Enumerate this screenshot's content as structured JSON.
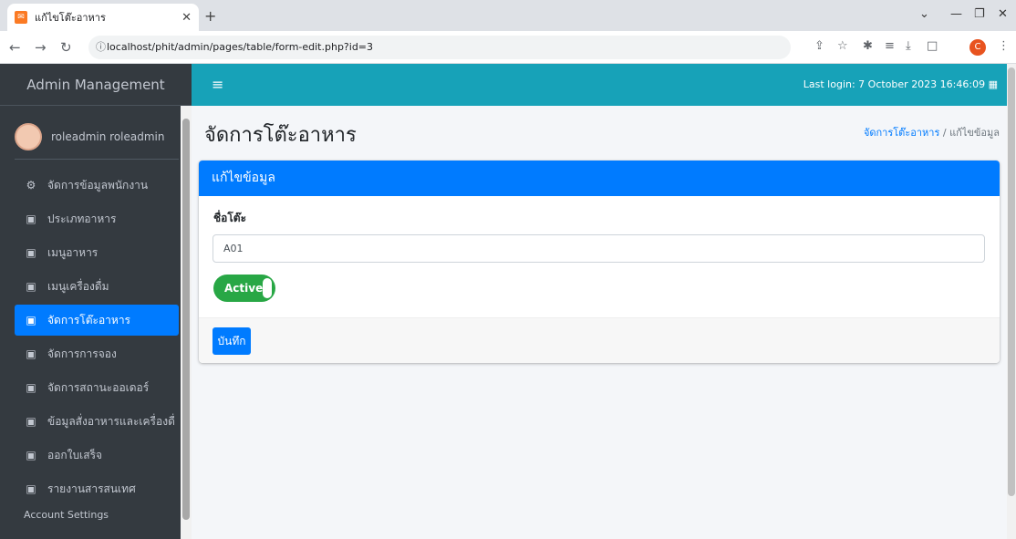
{
  "browser": {
    "tab_title": "แก้ไขโต๊ะอาหาร",
    "favicon_text": "✉",
    "url": "localhost/phit/admin/pages/table/form-edit.php?id=3",
    "profile_initial": "C"
  },
  "sidebar": {
    "brand": "Admin Management",
    "user_name": "roleadmin roleadmin",
    "items": [
      {
        "label": "จัดการข้อมูลพนักงาน",
        "icon": "users-cog-icon",
        "glyph": "⚙"
      },
      {
        "label": "ประเภทอาหาร",
        "icon": "chalkboard-teacher-icon",
        "glyph": "▣"
      },
      {
        "label": "เมนูอาหาร",
        "icon": "chalkboard-teacher-icon",
        "glyph": "▣"
      },
      {
        "label": "เมนูเครื่องดื่ม",
        "icon": "chalkboard-teacher-icon",
        "glyph": "▣"
      },
      {
        "label": "จัดการโต๊ะอาหาร",
        "icon": "chalkboard-teacher-icon",
        "glyph": "▣",
        "active": true
      },
      {
        "label": "จัดการการจอง",
        "icon": "chalkboard-teacher-icon",
        "glyph": "▣"
      },
      {
        "label": "จัดการสถานะออเดอร์",
        "icon": "chalkboard-teacher-icon",
        "glyph": "▣"
      },
      {
        "label": "ข้อมูลสั่งอาหารและเครื่องดื่",
        "icon": "chalkboard-teacher-icon",
        "glyph": "▣"
      },
      {
        "label": "ออกใบเสร็จ",
        "icon": "chalkboard-teacher-icon",
        "glyph": "▣"
      },
      {
        "label": "รายงานสารสนเทศ",
        "icon": "chalkboard-teacher-icon",
        "glyph": "▣"
      }
    ],
    "section_header": "Account Settings"
  },
  "topnav": {
    "last_login": "Last login: 7 October 2023 16:46:09"
  },
  "page": {
    "title": "จัดการโต๊ะอาหาร",
    "breadcrumb": {
      "link": "จัดการโต๊ะอาหาร",
      "separator": "/",
      "current": "แก้ไขข้อมูล"
    }
  },
  "form": {
    "header": "แก้ไขข้อมูล",
    "field_label": "ชื่อโต๊ะ",
    "field_value": "A01",
    "status_label": "Active",
    "save_label": "บันทึก"
  },
  "colors": {
    "navbar": "#17a2b8",
    "primary": "#007bff",
    "sidebar": "#343a40",
    "toggle_active": "#28a745"
  }
}
